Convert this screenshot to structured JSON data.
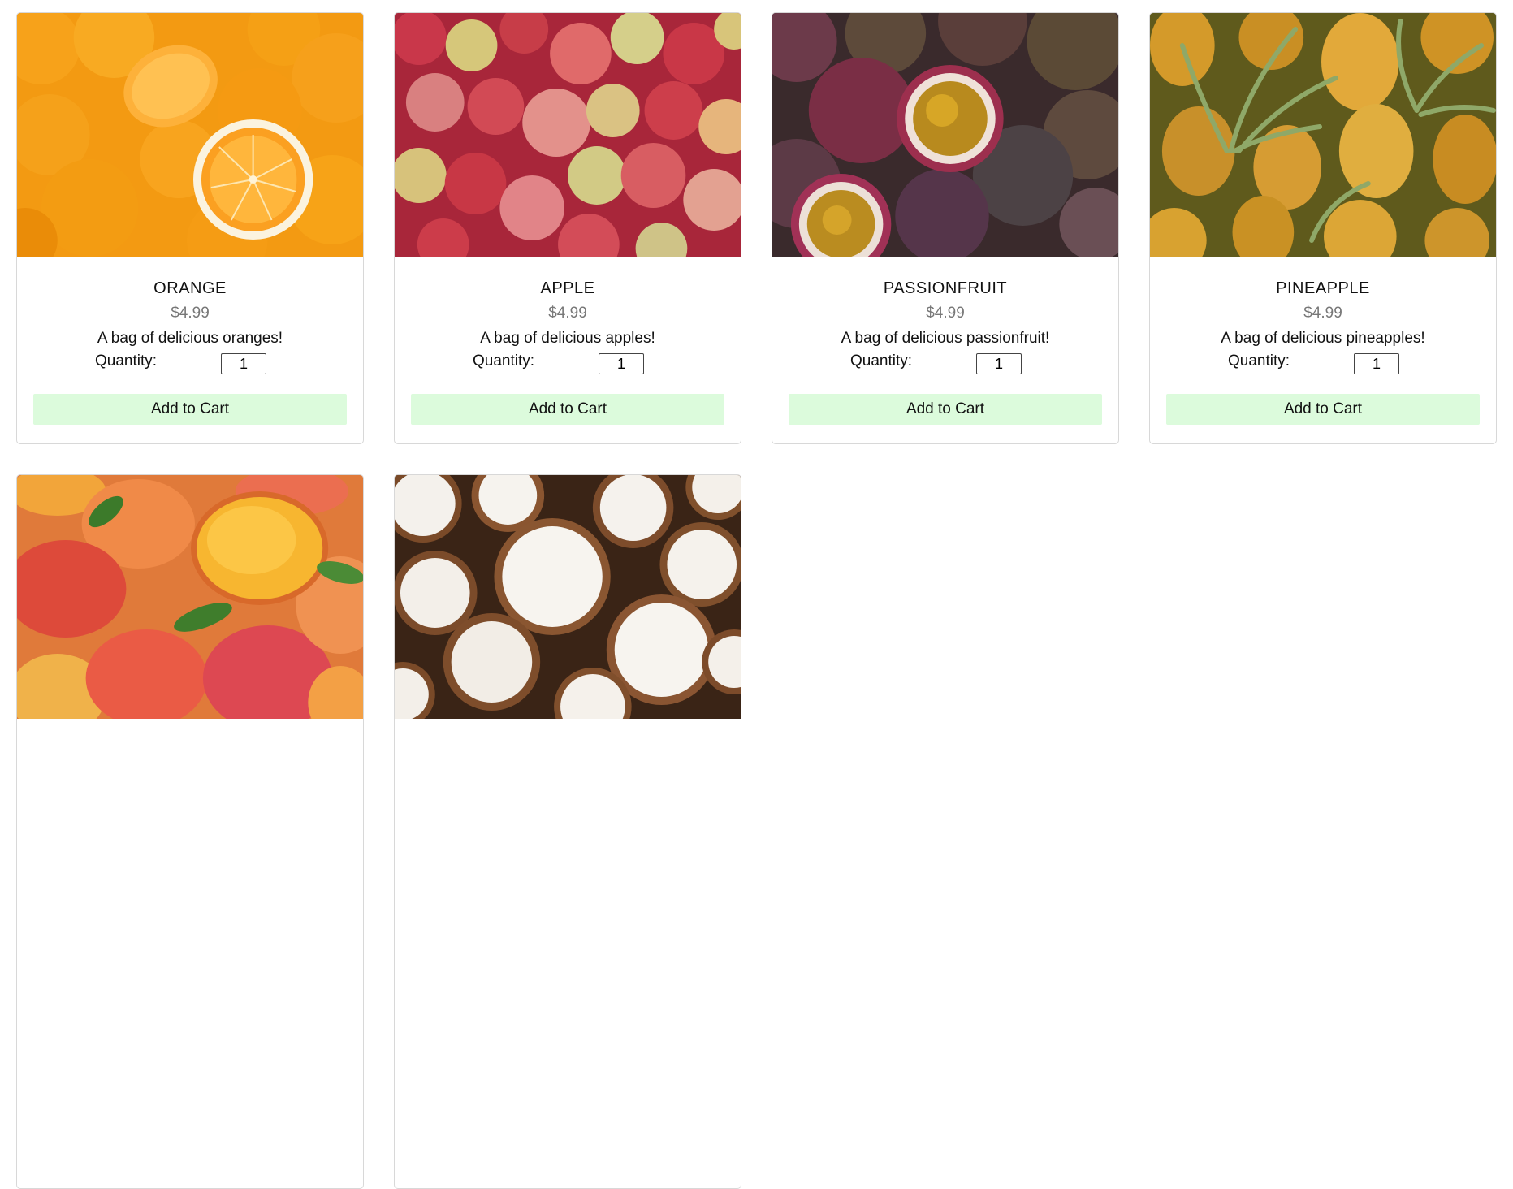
{
  "products": [
    {
      "name": "ORANGE",
      "price": "$4.99",
      "description": "A bag of delicious oranges!",
      "quantity_label": "Quantity:",
      "quantity": "1",
      "button": "Add to Cart"
    },
    {
      "name": "APPLE",
      "price": "$4.99",
      "description": "A bag of delicious apples!",
      "quantity_label": "Quantity:",
      "quantity": "1",
      "button": "Add to Cart"
    },
    {
      "name": "PASSIONFRUIT",
      "price": "$4.99",
      "description": "A bag of delicious passionfruit!",
      "quantity_label": "Quantity:",
      "quantity": "1",
      "button": "Add to Cart"
    },
    {
      "name": "PINEAPPLE",
      "price": "$4.99",
      "description": "A bag of delicious pineapples!",
      "quantity_label": "Quantity:",
      "quantity": "1",
      "button": "Add to Cart"
    },
    {
      "image": "mango-photo"
    },
    {
      "image": "coconut-photo"
    }
  ],
  "colors": {
    "button_bg": "#dcfbdc",
    "price": "#777777",
    "card_border": "#d8d8d8"
  }
}
